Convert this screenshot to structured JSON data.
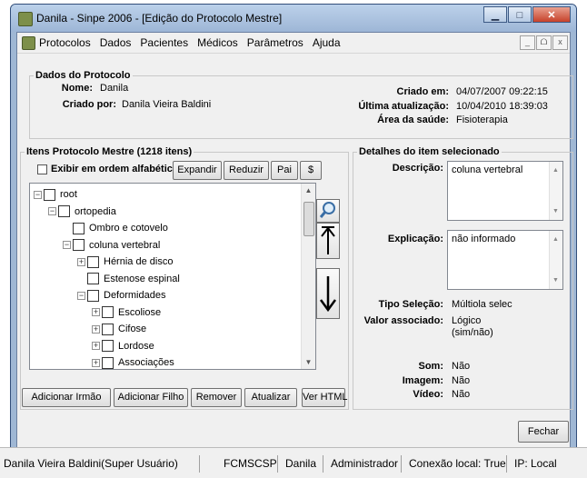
{
  "window": {
    "title": "Danila - Sinpe 2006 - [Edição do Protocolo Mestre]"
  },
  "menu": {
    "items": [
      "Protocolos",
      "Dados",
      "Pacientes",
      "Médicos",
      "Parâmetros",
      "Ajuda"
    ]
  },
  "protocol": {
    "legend": "Dados do Protocolo",
    "nome_label": "Nome:",
    "nome_value": "Danila",
    "criado_por_label": "Criado por:",
    "criado_por_value": "Danila Vieira Baldini",
    "criado_em_label": "Criado em:",
    "criado_em_value": "04/07/2007 09:22:15",
    "ultima_label": "Última atualização:",
    "ultima_value": "10/04/2010 18:39:03",
    "area_label": "Área da saúde:",
    "area_value": "Fisioterapia"
  },
  "items_panel": {
    "legend": "Itens Protocolo Mestre (1218 itens)",
    "alpha_label": "Exibir em ordem alfabética",
    "expand_label": "Expandir",
    "reduce_label": "Reduzir",
    "parent_label": "Pai",
    "dollar_label": "$",
    "tree": [
      {
        "label": "root",
        "level": 0,
        "expander": "−"
      },
      {
        "label": "ortopedia",
        "level": 1,
        "expander": "−"
      },
      {
        "label": "Ombro e cotovelo",
        "level": 2,
        "expander": ""
      },
      {
        "label": "coluna vertebral",
        "level": 2,
        "expander": "−"
      },
      {
        "label": "Hérnia de disco",
        "level": 3,
        "expander": "+"
      },
      {
        "label": "Estenose espinal",
        "level": 3,
        "expander": ""
      },
      {
        "label": "Deformidades",
        "level": 3,
        "expander": "−"
      },
      {
        "label": "Escoliose",
        "level": 4,
        "expander": "+"
      },
      {
        "label": "Cifose",
        "level": 4,
        "expander": "+"
      },
      {
        "label": "Lordose",
        "level": 4,
        "expander": "+"
      },
      {
        "label": "Associações",
        "level": 4,
        "expander": "+"
      }
    ],
    "add_sibling_label": "Adicionar Irmão",
    "add_child_label": "Adicionar Filho",
    "remove_label": "Remover",
    "update_label": "Atualizar",
    "view_html_label": "Ver HTML"
  },
  "details": {
    "legend": "Detalhes do item selecionado",
    "descricao_label": "Descrição:",
    "descricao_value": "coluna vertebral",
    "explicacao_label": "Explicação:",
    "explicacao_value": "não informado",
    "tipo_label": "Tipo Seleção:",
    "tipo_value": "Múltiola selec",
    "valor_label": "Valor associado:",
    "valor_value_1": "Lógico",
    "valor_value_2": "(sim/não)",
    "som_label": "Som:",
    "som_value": "Não",
    "imagem_label": "Imagem:",
    "imagem_value": "Não",
    "video_label": "Vídeo:",
    "video_value": "Não"
  },
  "close_label": "Fechar",
  "statusbar": {
    "user": "Danila Vieira Baldini(Super Usuário)",
    "db": "FCMSCSP",
    "login": "Danila",
    "role": "Administrador",
    "connection": "Conexão local: True",
    "ip": "IP: Local"
  },
  "icons": {
    "window_icon": "app-icon",
    "search": "magnifier-icon",
    "up": "up-arrow-icon",
    "down": "down-arrow-icon"
  }
}
